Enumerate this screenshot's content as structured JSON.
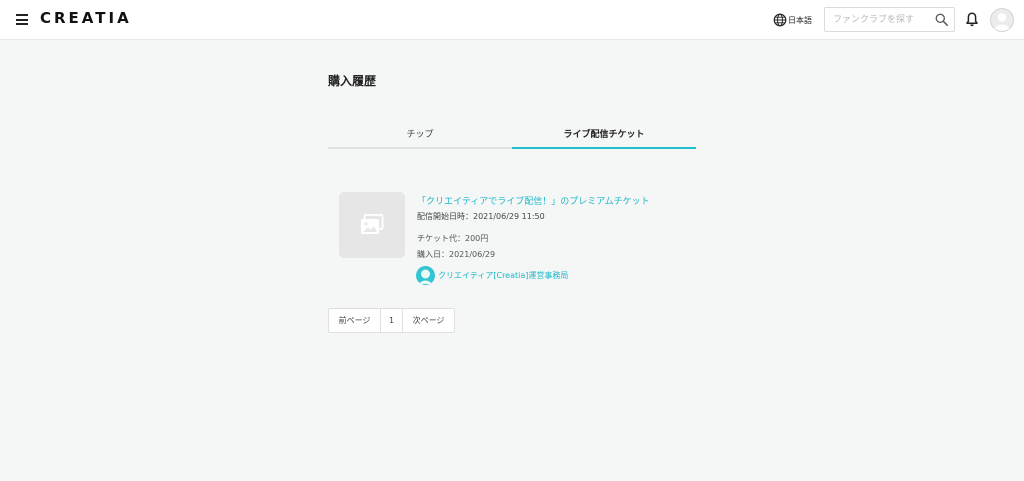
{
  "header": {
    "brand": "CREATIA",
    "language": "日本語",
    "search_placeholder": "ファンクラブを探す"
  },
  "page": {
    "title": "購入履歴"
  },
  "tabs": [
    {
      "label": "チップ",
      "active": false
    },
    {
      "label": "ライブ配信チケット",
      "active": true
    }
  ],
  "purchases": [
    {
      "title": "「クリエイティアでライブ配信！」のプレミアムチケット",
      "start": "配信開始日時：2021/06/29 11:50",
      "price": "チケット代：200円",
      "purchase_date": "購入日：2021/06/29",
      "creator": "クリエイティア[Creatia]運営事務局"
    }
  ],
  "pagination": {
    "prev": "前ページ",
    "current": "1",
    "next": "次ページ"
  },
  "colors": {
    "accent": "#1fbfcf",
    "background": "#f5f6f6"
  }
}
